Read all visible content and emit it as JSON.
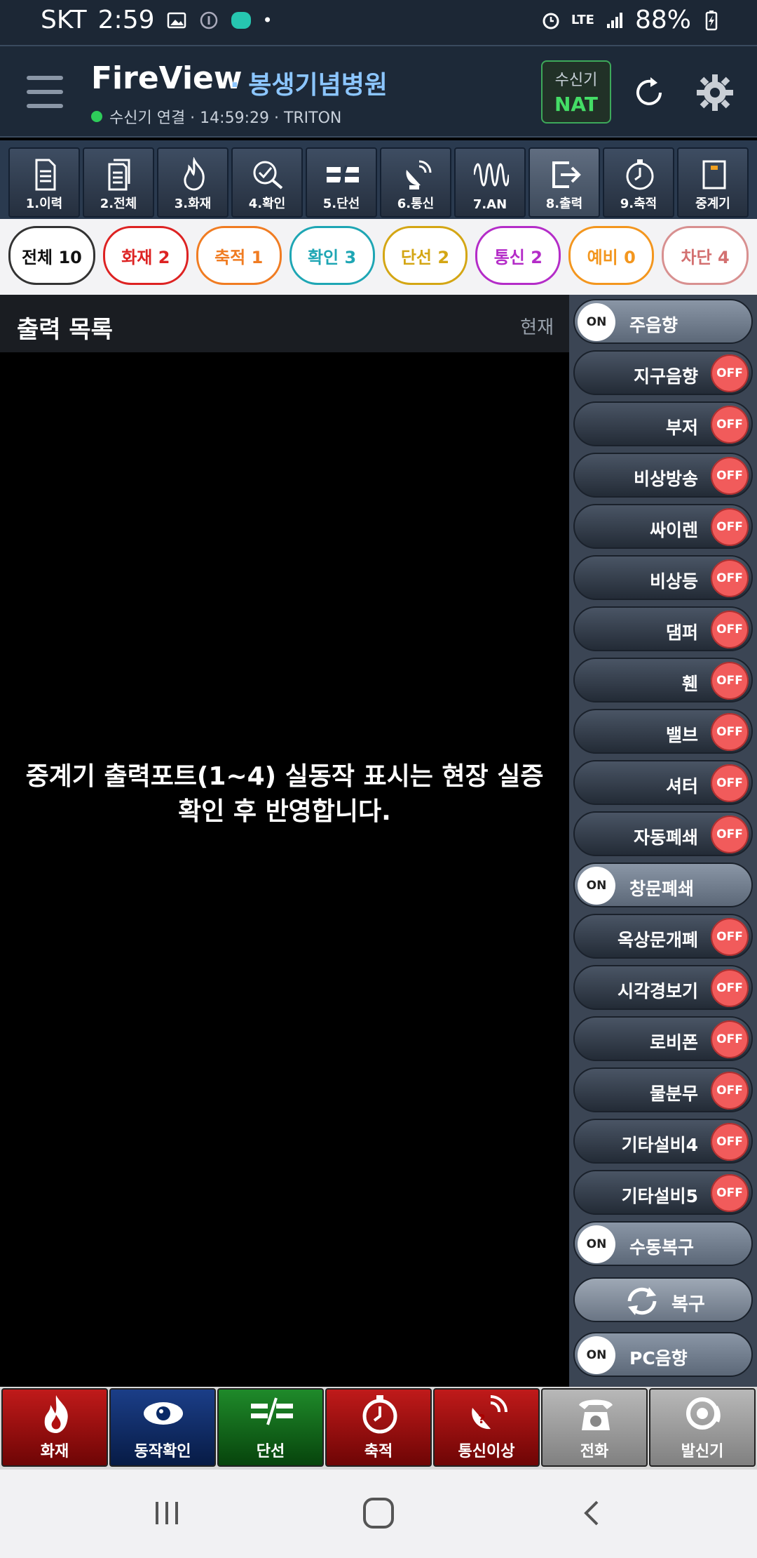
{
  "status_bar": {
    "carrier": "SKT",
    "time": "2:59",
    "network": "LTE",
    "battery": "88%"
  },
  "header": {
    "app_title": "FireView",
    "site_name": "· 봉생기념병원",
    "connection_text": "수신기 연결 · 14:59:29 · TRITON",
    "receiver_label": "수신기",
    "receiver_value": "NAT"
  },
  "toolbar": [
    {
      "label": "1.이력",
      "icon": "document-icon"
    },
    {
      "label": "2.전체",
      "icon": "documents-icon"
    },
    {
      "label": "3.화재",
      "icon": "flame-icon"
    },
    {
      "label": "4.확인",
      "icon": "check-search-icon"
    },
    {
      "label": "5.단선",
      "icon": "broken-line-icon"
    },
    {
      "label": "6.통신",
      "icon": "satellite-dish-icon"
    },
    {
      "label": "7.AN",
      "icon": "wave-icon"
    },
    {
      "label": "8.출력",
      "icon": "output-icon"
    },
    {
      "label": "9.축적",
      "icon": "timer-icon"
    },
    {
      "label": "중계기",
      "icon": "relay-icon"
    }
  ],
  "filters": [
    {
      "label": "전체 10"
    },
    {
      "label": "화재 2"
    },
    {
      "label": "축적 1"
    },
    {
      "label": "확인 3"
    },
    {
      "label": "단선 2"
    },
    {
      "label": "통신 2"
    },
    {
      "label": "예비 0"
    },
    {
      "label": "차단 4"
    }
  ],
  "list": {
    "title": "출력 목록",
    "column": "현재",
    "notice": "중계기 출력포트(1~4) 실동작 표시는 현장 실증 확인 후 반영합니다."
  },
  "panel": {
    "toggles": [
      {
        "label": "주음향",
        "state": "ON"
      },
      {
        "label": "지구음향",
        "state": "OFF"
      },
      {
        "label": "부저",
        "state": "OFF"
      },
      {
        "label": "비상방송",
        "state": "OFF"
      },
      {
        "label": "싸이렌",
        "state": "OFF"
      },
      {
        "label": "비상등",
        "state": "OFF"
      },
      {
        "label": "댐퍼",
        "state": "OFF"
      },
      {
        "label": "휀",
        "state": "OFF"
      },
      {
        "label": "밸브",
        "state": "OFF"
      },
      {
        "label": "셔터",
        "state": "OFF"
      },
      {
        "label": "자동폐쇄",
        "state": "OFF"
      },
      {
        "label": "창문폐쇄",
        "state": "ON"
      },
      {
        "label": "옥상문개폐",
        "state": "OFF"
      },
      {
        "label": "시각경보기",
        "state": "OFF"
      },
      {
        "label": "로비폰",
        "state": "OFF"
      },
      {
        "label": "물분무",
        "state": "OFF"
      },
      {
        "label": "기타설비4",
        "state": "OFF"
      },
      {
        "label": "기타설비5",
        "state": "OFF"
      },
      {
        "label": "수동복구",
        "state": "ON"
      }
    ],
    "restore_label": "복구",
    "pc_sound": {
      "label": "PC음향",
      "state": "ON"
    }
  },
  "actions": [
    {
      "label": "화재",
      "icon": "fire-icon"
    },
    {
      "label": "동작확인",
      "icon": "eye-icon"
    },
    {
      "label": "단선",
      "icon": "broken-wire-icon"
    },
    {
      "label": "축적",
      "icon": "timer-icon"
    },
    {
      "label": "통신이상",
      "icon": "signal-alert-icon"
    },
    {
      "label": "전화",
      "icon": "telephone-icon"
    },
    {
      "label": "발신기",
      "icon": "bell-icon"
    }
  ]
}
